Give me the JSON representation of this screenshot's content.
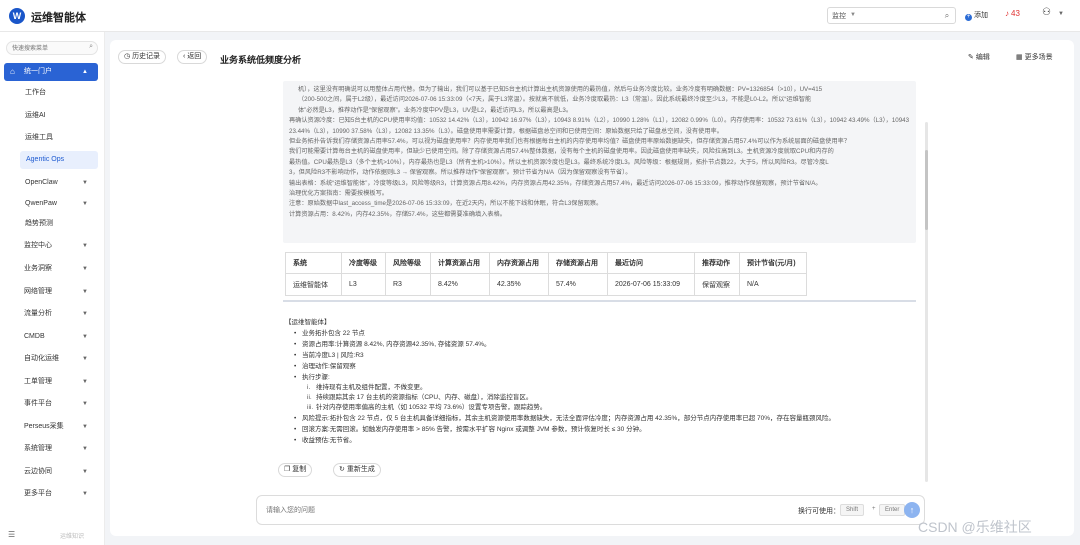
{
  "header": {
    "logo_text": "W",
    "app_title": "运维智能体",
    "search_scope": "监控",
    "search_placeholder": "",
    "add_label": "添加",
    "notif_count": "43"
  },
  "sidebar": {
    "search_placeholder": "快速搜索菜单",
    "items": [
      {
        "label": "统一门户"
      },
      {
        "label": "工作台"
      },
      {
        "label": "运维AI"
      },
      {
        "label": "运维工具"
      },
      {
        "label": "Agentic Ops"
      },
      {
        "label": "OpenClaw"
      },
      {
        "label": "QwenPaw"
      },
      {
        "label": "趋势预测"
      },
      {
        "label": "监控中心"
      },
      {
        "label": "业务洞察"
      },
      {
        "label": "网络管理"
      },
      {
        "label": "流量分析"
      },
      {
        "label": "CMDB"
      },
      {
        "label": "自动化运维"
      },
      {
        "label": "工单管理"
      },
      {
        "label": "事件平台"
      },
      {
        "label": "Perseus采集"
      },
      {
        "label": "系统管理"
      },
      {
        "label": "云边协同"
      },
      {
        "label": "更多平台"
      }
    ],
    "bottom_text": "运维知识"
  },
  "toolbar": {
    "history_label": "历史记录",
    "back_label": "返回",
    "page_title": "业务系统低频度分析",
    "edit_label": "编辑",
    "more_label": "更多场景"
  },
  "reasoning": [
    "机），这里没有明确说可以用整体占用代替。但为了输出，我们可以基于已知5台主机计算出主机资源使用的最热值，然后与业务冷度比较。业务冷度有明确数据：PV=1326854（>10），UV=415",
    "（200-500之间，属于L2级），最近访问2026-07-06 15:33:09（<7天，属于L3常温）。按就高不就低，业务冷度取最热：L3（常温）。因此系统最终冷度至少L3，不能是L0-L2。所以“运维智能",
    "体”必然是L3，推荐动作是“保留观察”。业务冷度中PV是L3，UV是L2，最近访问L3，所以最高是L3。",
    "再确认资源冷度：已知5台主机的CPU使用率均值：10532 14.42%（L3），10942 16.97%（L3），10943 8.91%（L2），10990 1.28%（L1），12082 0.99%（L0）。内存使用率：10532 73.61%（L3），10942 43.49%（L3），10943 23.44%（L3），10990 37.58%（L3），12082 13.35%（L3）。磁盘使用率需要计算，根据磁盘总空间和已使用空间：原始数据只给了磁盘总空间，没有使用率。",
    "但业务拓扑告诉我们存储资源占用率57.4%，可以视为磁盘使用率？内存使用率我们也有根据每台主机的内存使用率均值？磁盘使用率原始数据缺失，但存储资源占用57.4%可以作为系统层面的磁盘使用率？",
    "我们可能需要计算每台主机的磁盘使用率，但缺少已使用空间。除了存储资源占用57.4%整体数据，没有每个主机的磁盘使用率。因此磁盘使用率缺失，风险拉高到L3。主机资源冷度就取CPU和内存的",
    "最热值。CPU最热是L3（多个主机>10%），内存最热也是L3（所有主机>10%）。所以主机资源冷度也是L3。最终系统冷度L3。风险等级：根据规则，拓扑节点数22，大于5，所以风险R3。尽管冷度L",
    "3，但风险R3不影响动作，动作依据则L3 → 保留观察。所以推荐动作“保留观察”。预计节省为N/A（因为保留观察没有节省）。",
    "输出表格：系统“运维智能体”，冷度等级L3，风险等级R3，计算资源占用8.42%，内存资源占用42.35%，存储资源占用57.4%，最近访问2026-07-06 15:33:09，推荐动作保留观察，预计节省N/A。",
    "治理优化方案指南：需要按模板写。",
    "注意：原始数据中last_access_time是2026-07-06 15:33:09，在近2天内，所以不能下线和休眠，符合L3保留观察。",
    "计算资源占用：8.42%，内存42.35%，存储57.4%，这些都需要准确填入表格。"
  ],
  "table": {
    "headers": [
      "系统",
      "冷度等级",
      "风险等级",
      "计算资源占用",
      "内存资源占用",
      "存储资源占用",
      "最近访问",
      "推荐动作",
      "预计节省(元/月)"
    ],
    "rows": [
      [
        "运维智能体",
        "L3",
        "R3",
        "8.42%",
        "42.35%",
        "57.4%",
        "2026-07-06 15:33:09",
        "保留观察",
        "N/A"
      ]
    ]
  },
  "answer": {
    "heading": "【运维智能体】",
    "bullets1": [
      "业务拓扑包含 22 节点",
      "资源占用率:计算资源 8.42%, 内存资源42.35%, 存储资源 57.4%。",
      "当前冷度L3 | 风险:R3",
      "治理动作:保留观察",
      "执行步骤:"
    ],
    "steps": [
      {
        "num": "i.",
        "text": "维持现有主机及组件配置，不做变更。"
      },
      {
        "num": "ii.",
        "text": "持续跟踪其余 17 台主机的资源指标（CPU、内存、磁盘），消除监控盲区。"
      },
      {
        "num": "iii.",
        "text": "针对内存使用率偏高的主机（如 10532 平均 73.6%）设置专项告警，跟踪趋势。"
      }
    ],
    "bullets2": [
      "风险提示:拓扑包含 22 节点，仅 5 台主机具备详细指标，其余主机资源使用率数据缺失，无法全面评估冷度；内存资源占用 42.35%，部分节点内存使用率已超 70%，存在容量瓶颈风险。",
      "回滚方案:无需回滚。如触发内存使用率 > 85% 告警，按需水平扩容 Nginx 或调整 JVM 参数，预计恢复时长 ≤ 30 分钟。",
      "收益预估:无节省。"
    ],
    "copy_label": "复制",
    "regen_label": "重新生成"
  },
  "chat": {
    "placeholder": "请输入您的问题",
    "hint": "换行可使用：",
    "key1": "Shift",
    "key2": "Enter"
  },
  "watermark": "CSDN @乐维社区"
}
